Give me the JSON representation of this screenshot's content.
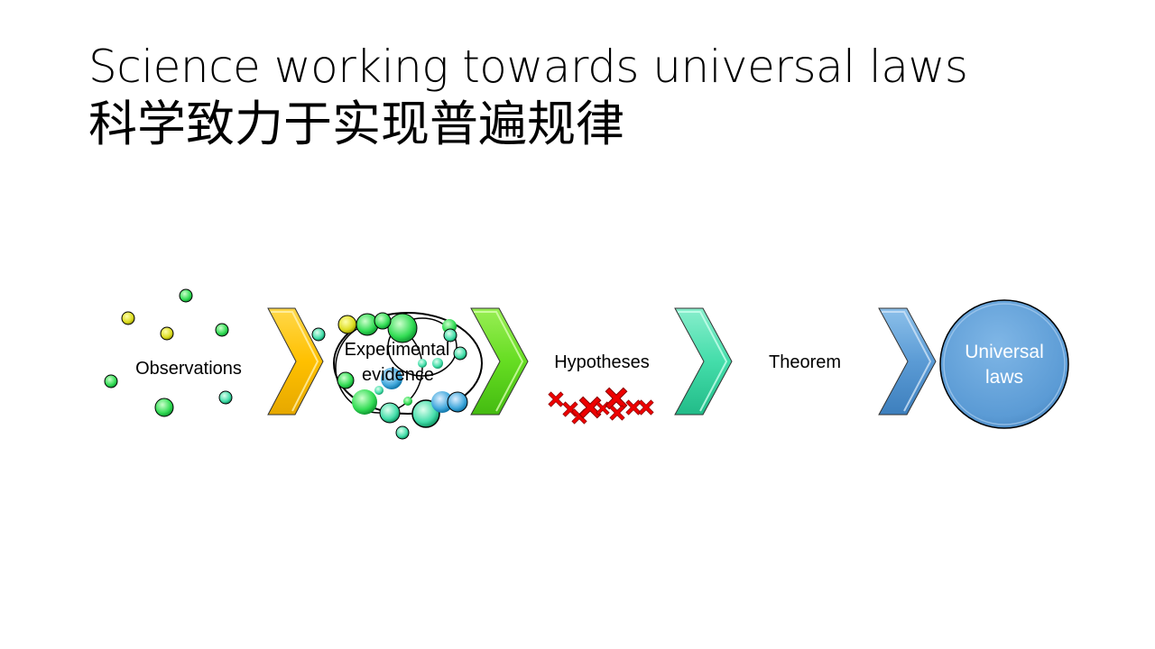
{
  "title": {
    "english": "Science working towards universal laws",
    "chinese": "科学致力于实现普遍规律"
  },
  "stages": {
    "observations": "Observations",
    "experimental_line1": "Experimental",
    "experimental_line2": "evidence",
    "hypotheses": "Hypotheses",
    "theorem": "Theorem",
    "universal_line1": "Universal",
    "universal_line2": "laws"
  },
  "colors": {
    "chevron_1": "#ffc000",
    "chevron_2": "#66dd22",
    "chevron_3": "#44ddaa",
    "chevron_4": "#5b9bd5",
    "circle_fill": "#5b9bd5",
    "cross": "#ee0000"
  }
}
